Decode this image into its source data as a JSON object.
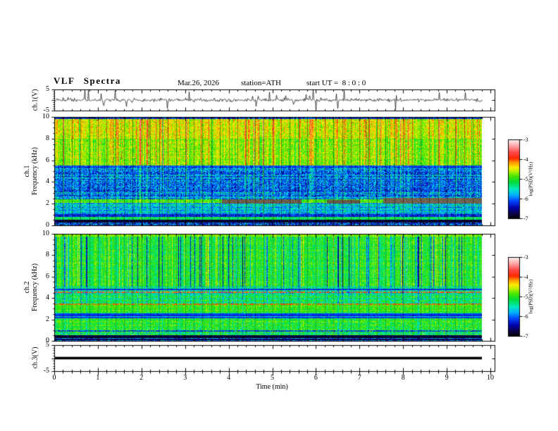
{
  "header": {
    "title": "VLF Spectra",
    "date": "Mar.26, 2026",
    "station": "station=ATH",
    "start_ut": "start UT =  8 : 0 : 0"
  },
  "axes": {
    "x_label": "Time (min)",
    "x_tick_labels": [
      "0",
      "1",
      "2",
      "3",
      "4",
      "5",
      "6",
      "7",
      "8",
      "9",
      "10"
    ],
    "x_range_min": [
      0,
      10
    ],
    "x_minor_step_min": 0.2,
    "data_end_min": 9.8
  },
  "colormap": [
    [
      -7.0,
      0,
      0,
      0
    ],
    [
      -6.75,
      15,
      0,
      70
    ],
    [
      -6.45,
      0,
      0,
      170
    ],
    [
      -6.1,
      0,
      70,
      255
    ],
    [
      -5.8,
      0,
      175,
      255
    ],
    [
      -5.5,
      0,
      235,
      190
    ],
    [
      -5.15,
      0,
      220,
      60
    ],
    [
      -4.85,
      70,
      230,
      0
    ],
    [
      -4.6,
      185,
      240,
      0
    ],
    [
      -4.4,
      255,
      235,
      0
    ],
    [
      -4.15,
      255,
      150,
      0
    ],
    [
      -3.95,
      255,
      40,
      0
    ],
    [
      -3.65,
      255,
      70,
      70
    ],
    [
      -3.35,
      255,
      155,
      155
    ],
    [
      -3.1,
      255,
      215,
      215
    ],
    [
      -3.0,
      255,
      255,
      255
    ]
  ],
  "chart_data": [
    {
      "type": "line",
      "name": "ch1_waveform",
      "ylabel": "ch.1(V)",
      "ylim": [
        -5,
        5
      ],
      "y_tick_labels": [
        "5",
        "-5"
      ],
      "description": "broadband noise around 0 V (~±1 V) with frequent impulsive spikes reaching ±5 V, 0 to 9.8 min",
      "seed": 911,
      "noise_sigma": 0.5,
      "spike_prob": 0.062,
      "spike_min": 0.8,
      "spike_max": 4.5,
      "line_color": "#000000"
    },
    {
      "type": "heatmap",
      "name": "ch1_spectrogram",
      "ylabel_line1": "ch.1",
      "ylabel_line2": "Frequency (kHz)",
      "ylim": [
        0,
        10
      ],
      "y_tick_labels": [
        "10",
        "8",
        "6",
        "4",
        "2",
        "0"
      ],
      "y_minor_step": 0.5,
      "colorbar": {
        "label": "log(PSD)(V²/Hz)",
        "tick_labels": [
          "-3",
          "-4",
          "-5",
          "-6",
          "-7"
        ],
        "lim": [
          -7,
          -3
        ]
      },
      "seed": 24601,
      "grid_alpha": 0.38,
      "streaks": {
        "hot_prob": 0.11,
        "hot_gain": 1.0,
        "cold_prob": 0.06,
        "cold_gain": 0.5
      },
      "bands": [
        {
          "f": [
            0.0,
            0.28
          ],
          "v": -6.3,
          "noise": 0.7,
          "streak": 0.2,
          "rowvar": 0.3
        },
        {
          "f": [
            0.28,
            0.5
          ],
          "v": -6.85,
          "noise": 0.3,
          "streak": 0.15,
          "rowvar": 0.0
        },
        {
          "f": [
            0.5,
            0.75
          ],
          "v": -5.15,
          "noise": 0.35,
          "streak": 0.25,
          "rowvar": 0.15
        },
        {
          "f": [
            0.75,
            1.05
          ],
          "v": -6.35,
          "noise": 0.35,
          "streak": 0.25,
          "rowvar": 0.2
        },
        {
          "f": [
            1.05,
            2.05
          ],
          "v": -5.75,
          "noise": 0.45,
          "streak": 0.4,
          "rowvar": 0.3
        },
        {
          "f": [
            2.05,
            2.4
          ],
          "v": -4.85,
          "noise": 0.3,
          "streak": 0.35,
          "rowvar": 0.1
        },
        {
          "f": [
            2.4,
            5.3
          ],
          "v": -5.9,
          "noise": 0.5,
          "streak": 0.6,
          "rowvar": 0.28
        },
        {
          "f": [
            5.3,
            5.5
          ],
          "v": -6.1,
          "noise": 0.25,
          "streak": 0.4,
          "rowvar": 0.1
        },
        {
          "f": [
            5.5,
            8.0
          ],
          "v": -4.7,
          "noise": 0.32,
          "streak": 1.0,
          "rowvar": 0.08
        },
        {
          "f": [
            8.0,
            9.82
          ],
          "v": -4.5,
          "noise": 0.3,
          "streak": 1.0,
          "rowvar": 0.08
        },
        {
          "f": [
            9.82,
            10.01
          ],
          "v": -6.3,
          "noise": 0.5,
          "streak": 0.3,
          "rowvar": 0.0
        }
      ],
      "hlines": [],
      "hsegments": [
        {
          "f": 2.25,
          "h": 0.18,
          "t": [
            3.85,
            5.65
          ],
          "rgb": [
            105,
            95,
            75
          ]
        },
        {
          "f": 2.2,
          "h": 0.15,
          "t": [
            6.25,
            7.0
          ],
          "rgb": [
            100,
            90,
            70
          ]
        },
        {
          "f": 2.3,
          "h": 0.22,
          "t": [
            7.55,
            9.8
          ],
          "rgb": [
            110,
            100,
            80
          ]
        }
      ]
    },
    {
      "type": "heatmap",
      "name": "ch2_spectrogram",
      "ylabel_line1": "ch.2",
      "ylabel_line2": "Frequency (kHz)",
      "ylim": [
        0,
        10
      ],
      "y_tick_labels": [
        "10",
        "8",
        "6",
        "4",
        "2",
        "0"
      ],
      "y_minor_step": 0.5,
      "colorbar": {
        "label": "log(PSD)(V²/Hz)",
        "tick_labels": [
          "-3",
          "-4",
          "-5",
          "-6",
          "-7"
        ],
        "lim": [
          -7,
          -3
        ]
      },
      "seed": 77031,
      "grid_alpha": 0.2,
      "streaks": {
        "hot_prob": 0.06,
        "hot_gain": 0.65,
        "cold_prob": 0.13,
        "cold_gain": 1.5
      },
      "bands": [
        {
          "f": [
            0.0,
            0.5
          ],
          "v": -5.75,
          "noise": 0.6,
          "streak": 0.25,
          "rowvar": 0.55
        },
        {
          "f": [
            0.5,
            1.15
          ],
          "v": -5.2,
          "noise": 0.45,
          "streak": 0.3,
          "rowvar": 0.4
        },
        {
          "f": [
            1.15,
            2.05
          ],
          "v": -5.0,
          "noise": 0.35,
          "streak": 0.3,
          "rowvar": 0.15
        },
        {
          "f": [
            2.05,
            2.65
          ],
          "v": -5.4,
          "noise": 0.4,
          "streak": 0.25,
          "rowvar": 0.5
        },
        {
          "f": [
            2.65,
            3.5
          ],
          "v": -4.95,
          "noise": 0.25,
          "streak": 0.3,
          "rowvar": 0.08
        },
        {
          "f": [
            3.5,
            4.25
          ],
          "v": -5.2,
          "noise": 0.4,
          "streak": 0.4,
          "rowvar": 0.25
        },
        {
          "f": [
            4.25,
            4.6
          ],
          "v": -5.6,
          "noise": 0.5,
          "streak": 0.35,
          "rowvar": 0.4
        },
        {
          "f": [
            4.6,
            5.05
          ],
          "v": -5.35,
          "noise": 0.35,
          "streak": 0.45,
          "rowvar": 0.3
        },
        {
          "f": [
            5.05,
            9.75
          ],
          "v": -5.05,
          "noise": 0.3,
          "streak": 1.0,
          "rowvar": 0.1
        },
        {
          "f": [
            9.75,
            10.01
          ],
          "v": -4.75,
          "noise": 0.25,
          "streak": 0.3,
          "rowvar": 0.0
        }
      ],
      "hlines": [
        {
          "f": 4.82,
          "v": -6.2,
          "dash": 0
        },
        {
          "f": 4.52,
          "v": -4.05,
          "dash": 0.35
        },
        {
          "f": 3.42,
          "v": -3.95,
          "dash": 0.4
        },
        {
          "f": 2.5,
          "v": -6.15,
          "dash": 0
        },
        {
          "f": 2.34,
          "v": -6.25,
          "dash": 0
        },
        {
          "f": 2.18,
          "v": -6.15,
          "dash": 0
        },
        {
          "f": 0.95,
          "v": -6.2,
          "dash": 0.25
        },
        {
          "f": 0.44,
          "v": -6.8,
          "dash": 0
        },
        {
          "f": 0.3,
          "v": -6.85,
          "dash": 0
        },
        {
          "f": 0.16,
          "v": -6.7,
          "dash": 0
        }
      ],
      "hsegments": []
    },
    {
      "type": "line",
      "name": "ch3_waveform",
      "ylabel": "ch.3(V)",
      "ylim": [
        -5,
        5
      ],
      "y_tick_labels": [
        "5",
        "-5"
      ],
      "constant_value": 0,
      "description": "flat (constant 0 V) thick trace, 0 to 9.8 min",
      "line_color": "#000000"
    }
  ]
}
